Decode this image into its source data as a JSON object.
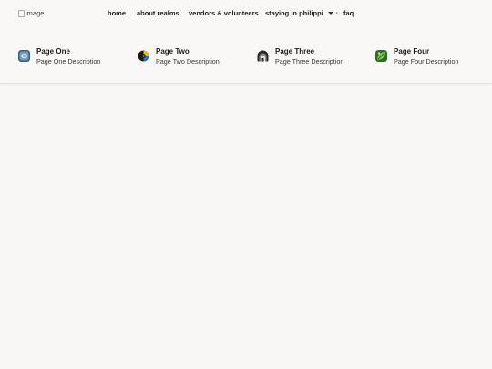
{
  "header": {
    "logo_alt": "image",
    "nav": {
      "home": "home",
      "about": "about realms",
      "vendors": "vendors & volunteers",
      "staying": "staying in philippi",
      "faq": "faq"
    }
  },
  "pages": [
    {
      "title": "Page One",
      "description": "Page One Description",
      "icon": "globe-app-icon"
    },
    {
      "title": "Page Two",
      "description": "Page Two Description",
      "icon": "record-icon"
    },
    {
      "title": "Page Three",
      "description": "Page Three Description",
      "icon": "arch-icon"
    },
    {
      "title": "Page Four",
      "description": "Page Four Description",
      "icon": "leaf-icon"
    }
  ],
  "colors": {
    "background": "#f8f7f5",
    "text": "#1d1d1d"
  }
}
